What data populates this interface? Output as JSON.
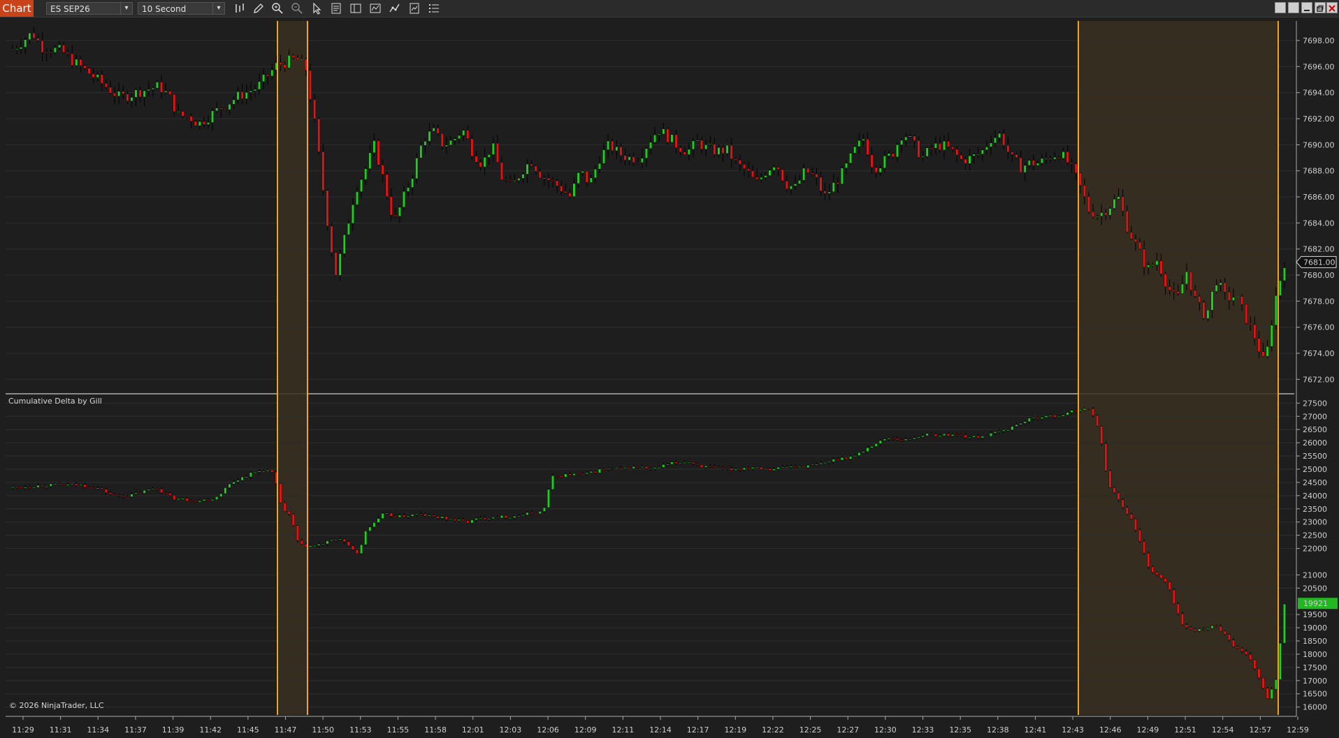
{
  "app": {
    "tab_label": "Chart"
  },
  "toolbar": {
    "instrument": "ES SEP26",
    "interval": "10 Second",
    "icons": [
      "bar-type-icon",
      "draw-pencil-icon",
      "zoom-in-icon",
      "zoom-out-icon",
      "pointer-icon",
      "data-box-icon",
      "properties-icon",
      "strategies-icon",
      "indicators-icon",
      "templates-icon",
      "list-icon"
    ]
  },
  "price_panel": {
    "y_ticks": [
      "7698.00",
      "7696.00",
      "7694.00",
      "7692.00",
      "7690.00",
      "7688.00",
      "7686.00",
      "7684.00",
      "7682.00",
      "7680.00",
      "7678.00",
      "7676.00",
      "7674.00",
      "7672.00"
    ],
    "last_price_label": "7681.00"
  },
  "delta_panel": {
    "title": "Cumulative Delta by Gill",
    "y_ticks": [
      "27500",
      "27000",
      "26500",
      "26000",
      "25500",
      "25000",
      "24500",
      "24000",
      "23500",
      "23000",
      "22500",
      "22000",
      "21000",
      "20500",
      "19500",
      "19000",
      "18500",
      "18000",
      "17500",
      "17000",
      "16500",
      "16000"
    ],
    "last_value_label": "19921"
  },
  "x_axis": {
    "ticks": [
      "11:29",
      "11:31",
      "11:34",
      "11:37",
      "11:39",
      "11:42",
      "11:45",
      "11:47",
      "11:50",
      "11:53",
      "11:55",
      "11:58",
      "12:01",
      "12:03",
      "12:06",
      "12:09",
      "12:11",
      "12:14",
      "12:17",
      "12:19",
      "12:22",
      "12:25",
      "12:27",
      "12:30",
      "12:33",
      "12:35",
      "12:38",
      "12:41",
      "12:43",
      "12:46",
      "12:49",
      "12:51",
      "12:54",
      "12:57",
      "12:59"
    ]
  },
  "copyright": "© 2026 NinjaTrader, LLC",
  "colors": {
    "up": "#22cc22",
    "down": "#e01515",
    "marker": "#f0a520",
    "shade": "#3a3020",
    "background": "#1e1e1e",
    "grid": "#2e2e2e",
    "last_delta_bg": "#22b822"
  },
  "chart_data": [
    {
      "type": "candlestick",
      "title": "ES SEP26 — 10 Second",
      "ylim": [
        7671,
        7699.5
      ],
      "path": [
        [
          0,
          7697.3
        ],
        [
          2,
          7698.6
        ],
        [
          3,
          7697.5
        ],
        [
          5,
          7697.2
        ],
        [
          6,
          7696.5
        ],
        [
          8,
          7695.4
        ],
        [
          10,
          7694.2
        ],
        [
          11,
          7693.6
        ],
        [
          13,
          7694.1
        ],
        [
          15,
          7694.5
        ],
        [
          16,
          7693.7
        ],
        [
          17,
          7692.2
        ],
        [
          18,
          7692.2
        ],
        [
          19,
          7691.6
        ],
        [
          21,
          7692.7
        ],
        [
          23,
          7693.7
        ],
        [
          25,
          7694.4
        ],
        [
          27,
          7696.1
        ],
        [
          29,
          7696.6
        ],
        [
          30,
          7695.8
        ],
        [
          31,
          7691.0
        ],
        [
          32,
          7685.0
        ],
        [
          33,
          7680.0
        ],
        [
          34,
          7683.0
        ],
        [
          35,
          7686.5
        ],
        [
          36,
          7688.0
        ],
        [
          37,
          7690.0
        ],
        [
          38,
          7687.0
        ],
        [
          39,
          7684.0
        ],
        [
          40,
          7686.0
        ],
        [
          41,
          7688.0
        ],
        [
          42,
          7690.5
        ],
        [
          43,
          7691.0
        ],
        [
          44,
          7690.0
        ],
        [
          45,
          7690.3
        ],
        [
          46,
          7691.2
        ],
        [
          47,
          7689.5
        ],
        [
          48,
          7688.5
        ],
        [
          49,
          7690.0
        ],
        [
          50,
          7687.5
        ],
        [
          51,
          7686.7
        ],
        [
          52,
          7688.0
        ],
        [
          53,
          7688.8
        ],
        [
          54,
          7687.7
        ],
        [
          55,
          7687.2
        ],
        [
          56,
          7686.7
        ],
        [
          57,
          7686.0
        ],
        [
          58,
          7688.0
        ],
        [
          59,
          7687.0
        ],
        [
          60,
          7689.0
        ],
        [
          61,
          7690.0
        ],
        [
          62,
          7689.3
        ],
        [
          63,
          7689.0
        ],
        [
          64,
          7689.0
        ],
        [
          65,
          7690.2
        ],
        [
          66,
          7691.2
        ],
        [
          67,
          7690.6
        ],
        [
          68,
          7689.9
        ],
        [
          69,
          7689.5
        ],
        [
          70,
          7690.2
        ],
        [
          71,
          7689.7
        ],
        [
          72,
          7689.5
        ],
        [
          73,
          7689.6
        ],
        [
          74,
          7688.5
        ],
        [
          75,
          7688.0
        ],
        [
          76,
          7687.0
        ],
        [
          77,
          7688.0
        ],
        [
          78,
          7688.7
        ],
        [
          79,
          7687.0
        ],
        [
          80,
          7686.7
        ],
        [
          81,
          7688.0
        ],
        [
          82,
          7687.5
        ],
        [
          83,
          7686.0
        ],
        [
          84,
          7687.0
        ],
        [
          85,
          7688.0
        ],
        [
          86,
          7689.5
        ],
        [
          87,
          7690.5
        ],
        [
          88,
          7688.2
        ],
        [
          89,
          7688.7
        ],
        [
          90,
          7689.4
        ],
        [
          91,
          7691.0
        ],
        [
          92,
          7690.1
        ],
        [
          93,
          7689.0
        ],
        [
          94,
          7689.8
        ],
        [
          95,
          7690.0
        ],
        [
          96,
          7689.5
        ],
        [
          97,
          7688.8
        ],
        [
          98,
          7689.0
        ],
        [
          99,
          7689.4
        ],
        [
          100,
          7690.5
        ],
        [
          101,
          7690.8
        ],
        [
          102,
          7689.0
        ],
        [
          103,
          7688.3
        ],
        [
          104,
          7688.6
        ],
        [
          105,
          7688.6
        ],
        [
          106,
          7689.1
        ],
        [
          107,
          7689.4
        ],
        [
          108,
          7688.5
        ],
        [
          109,
          7687.0
        ],
        [
          110,
          7685.0
        ],
        [
          111,
          7684.6
        ],
        [
          112,
          7685.2
        ],
        [
          113,
          7686.0
        ],
        [
          114,
          7683.5
        ],
        [
          115,
          7682.0
        ],
        [
          116,
          7680.4
        ],
        [
          117,
          7681.2
        ],
        [
          118,
          7679.2
        ],
        [
          119,
          7678.0
        ],
        [
          120,
          7680.3
        ],
        [
          121,
          7677.8
        ],
        [
          122,
          7676.8
        ],
        [
          123,
          7679.7
        ],
        [
          124,
          7678.2
        ],
        [
          125,
          7678.4
        ],
        [
          126,
          7676.8
        ],
        [
          127,
          7675.2
        ],
        [
          128,
          7673.0
        ],
        [
          129,
          7678.0
        ],
        [
          130,
          7681.0
        ]
      ]
    },
    {
      "type": "candlestick",
      "title": "Cumulative Delta by Gill",
      "ylim": [
        15700,
        27800
      ],
      "path": [
        [
          0,
          24300
        ],
        [
          4,
          24400
        ],
        [
          8,
          24400
        ],
        [
          10,
          24300
        ],
        [
          12,
          24000
        ],
        [
          14,
          24000
        ],
        [
          17,
          24300
        ],
        [
          19,
          23900
        ],
        [
          22,
          23800
        ],
        [
          24,
          23900
        ],
        [
          26,
          24500
        ],
        [
          28,
          24800
        ],
        [
          30,
          25000
        ],
        [
          31,
          24800
        ],
        [
          32,
          23500
        ],
        [
          33,
          23200
        ],
        [
          34,
          22100
        ],
        [
          36,
          22100
        ],
        [
          38,
          22300
        ],
        [
          39,
          22400
        ],
        [
          40,
          22000
        ],
        [
          41,
          21800
        ],
        [
          42,
          22700
        ],
        [
          43,
          23000
        ],
        [
          44,
          23300
        ],
        [
          46,
          23200
        ],
        [
          48,
          23300
        ],
        [
          50,
          23200
        ],
        [
          52,
          23100
        ],
        [
          54,
          23000
        ],
        [
          55,
          23100
        ],
        [
          57,
          23200
        ],
        [
          59,
          23200
        ],
        [
          61,
          23300
        ],
        [
          63,
          23400
        ],
        [
          64,
          24700
        ],
        [
          66,
          24800
        ],
        [
          68,
          24800
        ],
        [
          70,
          25000
        ],
        [
          72,
          25000
        ],
        [
          74,
          25100
        ],
        [
          76,
          25000
        ],
        [
          78,
          25200
        ],
        [
          80,
          25300
        ],
        [
          82,
          25100
        ],
        [
          84,
          25000
        ],
        [
          86,
          25000
        ],
        [
          88,
          25100
        ],
        [
          90,
          25000
        ],
        [
          92,
          25100
        ],
        [
          94,
          25100
        ],
        [
          96,
          25200
        ],
        [
          98,
          25400
        ],
        [
          100,
          25500
        ],
        [
          102,
          25900
        ],
        [
          104,
          26200
        ],
        [
          106,
          26100
        ],
        [
          108,
          26300
        ],
        [
          110,
          26300
        ],
        [
          112,
          26300
        ],
        [
          114,
          26200
        ],
        [
          116,
          26300
        ],
        [
          118,
          26500
        ],
        [
          120,
          26800
        ],
        [
          122,
          27000
        ],
        [
          124,
          27000
        ],
        [
          126,
          27200
        ],
        [
          128,
          27300
        ],
        [
          129,
          26500
        ],
        [
          130,
          24500
        ],
        [
          131,
          24000
        ],
        [
          133,
          23000
        ],
        [
          135,
          21200
        ],
        [
          137,
          20700
        ],
        [
          139,
          19000
        ],
        [
          141,
          18900
        ],
        [
          143,
          19100
        ],
        [
          145,
          18300
        ],
        [
          147,
          17800
        ],
        [
          149,
          16300
        ],
        [
          150,
          17000
        ],
        [
          151,
          19921
        ]
      ]
    }
  ]
}
